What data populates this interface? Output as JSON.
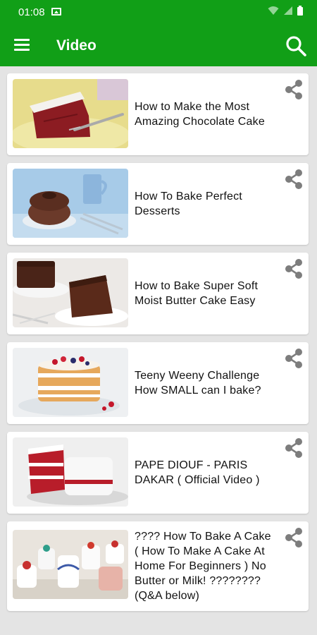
{
  "status_bar": {
    "time": "01:08"
  },
  "app_bar": {
    "title": "Video"
  },
  "colors": {
    "primary": "#119f17",
    "background": "#e4e4e4",
    "card": "#ffffff",
    "icon_gray": "#7d7d7d"
  },
  "videos": [
    {
      "title": "How to Make the Most Amazing Chocolate Cake",
      "thumbnail": "red-velvet-cake-slice"
    },
    {
      "title": "How To Bake Perfect Desserts",
      "thumbnail": "chocolate-bundt-cake"
    },
    {
      "title": "How to Bake Super Soft Moist Butter Cake Easy",
      "thumbnail": "chocolate-cake-slice"
    },
    {
      "title": " Teeny Weeny Challenge How SMALL can I bake?",
      "thumbnail": "berry-naked-cake"
    },
    {
      "title": "PAPE DIOUF - PARIS DAKAR ( Official Video )",
      "thumbnail": "red-velvet-layer-cake"
    },
    {
      "title": "???? How To Bake A Cake ( How To Make A Cake At Home For Beginners ) No Butter or Milk! ???????? (Q&A below)",
      "thumbnail": "mini-cakes"
    }
  ]
}
